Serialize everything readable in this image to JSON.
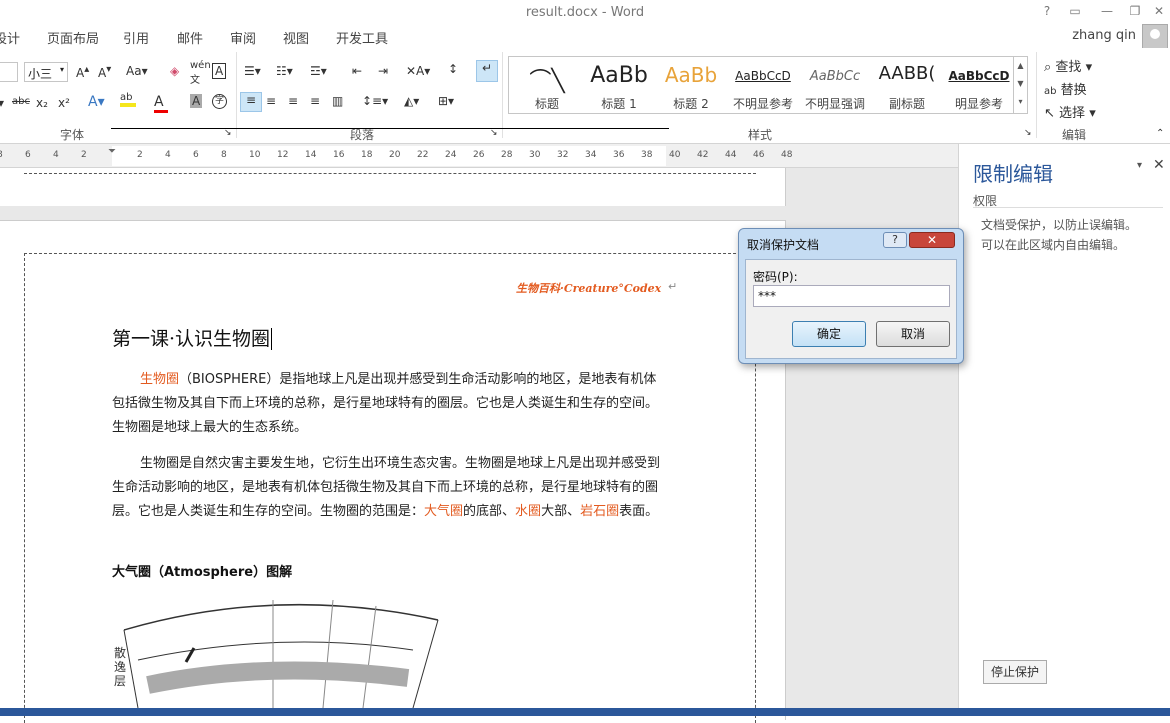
{
  "window": {
    "title": "result.docx - Word"
  },
  "tabs": [
    "设计",
    "页面布局",
    "引用",
    "邮件",
    "审阅",
    "视图",
    "开发工具"
  ],
  "user": {
    "name": "zhang qin"
  },
  "ribbon": {
    "font_name": "",
    "font_size": "小三",
    "group_font": "字体",
    "group_paragraph": "段落",
    "group_styles": "样式",
    "group_editing": "编辑",
    "styles": [
      {
        "preview": "⌒╲",
        "name": "标题"
      },
      {
        "preview": "AaBb",
        "name": "标题 1"
      },
      {
        "preview": "AaBb",
        "name": "标题 2"
      },
      {
        "preview": "AaBbCcD",
        "name": "不明显参考"
      },
      {
        "preview": "AaBbCc",
        "name": "不明显强调"
      },
      {
        "preview": "AABB(",
        "name": "副标题"
      },
      {
        "preview": "AaBbCcD",
        "name": "明显参考"
      }
    ],
    "find": "查找",
    "replace": "替换",
    "select": "选择"
  },
  "ruler": [
    "8",
    "6",
    "4",
    "2",
    "",
    "2",
    "4",
    "6",
    "8",
    "10",
    "12",
    "14",
    "16",
    "18",
    "20",
    "22",
    "24",
    "26",
    "28",
    "30",
    "32",
    "34",
    "36",
    "38",
    "40",
    "42",
    "44",
    "46",
    "48"
  ],
  "document": {
    "header": "生物百科·Creature°Codex",
    "heading": "第一课·认识生物圈",
    "p1_red": "生物圈",
    "p1": "（BIOSPHERE）是指地球上凡是出现并感受到生命活动影响的地区，是地表有机体包括微生物及其自下而上环境的总称，是行星地球特有的圈层。它也是人类诞生和生存的空间。生物圈是地球上最大的生态系统。",
    "p2_a": "生物圈是自然灾害主要发生地，它衍生出环境生态灾害。生物圈是地球上凡是出现并感受到生命活动影响的地区，是地表有机体包括微生物及其自下而上环境的总称，是行星地球特有的圈层。它也是人类诞生和生存的空间。生物圈的范围是：",
    "p2_r1": "大气圈",
    "p2_b": "的底部、",
    "p2_r2": "水圈",
    "p2_c": "大部、",
    "p2_r3": "岩石圈",
    "p2_d": "表面。",
    "subheading": "大气圈（Atmosphere）图解",
    "diagram_label": "散逸层"
  },
  "restrict_pane": {
    "title": "限制编辑",
    "subtitle": "权限",
    "line1": "文档受保护，以防止误编辑。",
    "line2": "可以在此区域内自由编辑。",
    "stop_button": "停止保护"
  },
  "dialog": {
    "title": "取消保护文档",
    "help": "?",
    "close": "✕",
    "password_label": "密码(P):",
    "password_value": "***",
    "ok": "确定",
    "cancel": "取消"
  },
  "colors": {
    "accent": "#2b579a",
    "red_text": "#e35b20"
  }
}
